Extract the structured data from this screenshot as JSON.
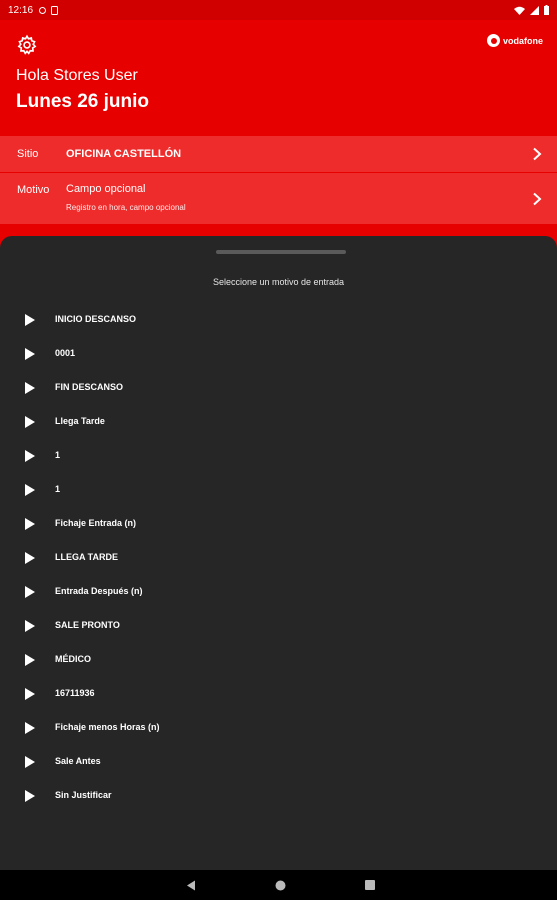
{
  "status_bar": {
    "time": "12:16"
  },
  "header": {
    "brand": "vodafone",
    "greeting": "Hola Stores User",
    "date": "Lunes 26 junio"
  },
  "site_row": {
    "label": "Sitio",
    "value": "OFICINA CASTELLÓN"
  },
  "reason_row": {
    "label": "Motivo",
    "value": "Campo opcional",
    "hint": "Registro en hora, campo opcional"
  },
  "sheet": {
    "title": "Seleccione un motivo de entrada",
    "options": [
      "INICIO DESCANSO",
      "0001",
      "FIN DESCANSO",
      "Llega Tarde",
      "1",
      "1",
      "Fichaje Entrada (n)",
      "LLEGA TARDE",
      "Entrada Después (n)",
      "SALE PRONTO",
      "MÉDICO",
      "16711936",
      "Fichaje menos Horas (n)",
      "Sale Antes",
      "Sin Justificar"
    ]
  },
  "colors": {
    "accent": "#e60000",
    "row": "#ee2c2c",
    "sheet": "#262626"
  },
  "icons": [
    "settings-gear-icon",
    "vodafone-logo-icon",
    "chevron-right-icon",
    "play-icon",
    "nav-back-icon",
    "nav-home-icon",
    "nav-recents-icon"
  ]
}
